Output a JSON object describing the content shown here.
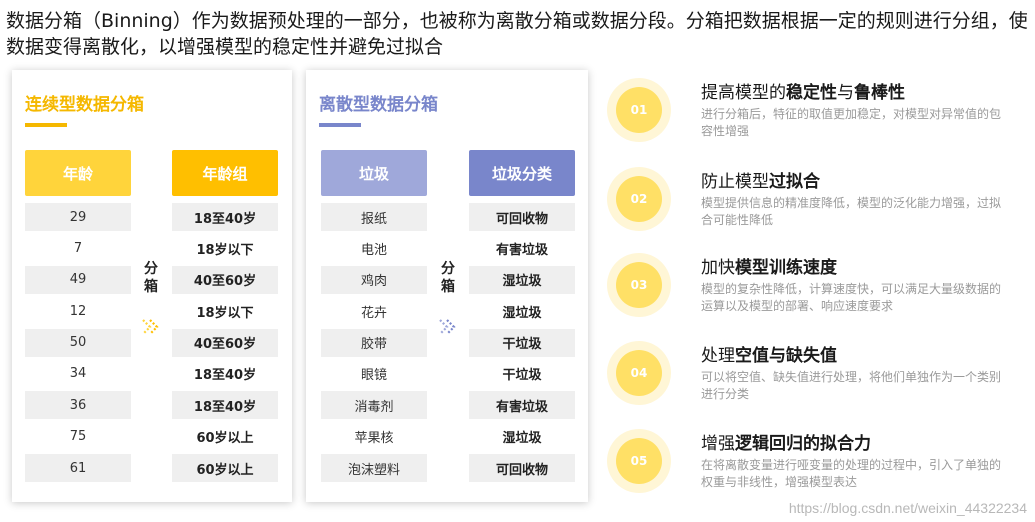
{
  "header": {
    "text": "数据分箱（Binning）作为数据预处理的一部分，也被称为离散分箱或数据分段。分箱把数据根据一定的规则进行分组，使数据变得离散化，以增强模型的稳定性并避免过拟合"
  },
  "continuous": {
    "title": "连续型数据分箱",
    "left_header": "年龄",
    "right_header": "年龄组",
    "mid_label": "分箱",
    "left": [
      "29",
      "7",
      "49",
      "12",
      "50",
      "34",
      "36",
      "75",
      "61"
    ],
    "right": [
      "18至40岁",
      "18岁以下",
      "40至60岁",
      "18岁以下",
      "40至60岁",
      "18至40岁",
      "18至40岁",
      "60岁以上",
      "60岁以上"
    ]
  },
  "discrete": {
    "title": "离散型数据分箱",
    "left_header": "垃圾",
    "right_header": "垃圾分类",
    "mid_label": "分箱",
    "left": [
      "报纸",
      "电池",
      "鸡肉",
      "花卉",
      "胶带",
      "眼镜",
      "消毒剂",
      "苹果核",
      "泡沫塑料"
    ],
    "right": [
      "可回收物",
      "有害垃圾",
      "湿垃圾",
      "湿垃圾",
      "干垃圾",
      "干垃圾",
      "有害垃圾",
      "湿垃圾",
      "可回收物"
    ]
  },
  "features": [
    {
      "num": "01",
      "title_pre": "提高模型的",
      "title_b1": "稳定性",
      "title_mid": "与",
      "title_b2": "鲁棒性",
      "desc": "进行分箱后，特征的取值更加稳定，对模型对异常值的包容性增强"
    },
    {
      "num": "02",
      "title_pre": "防止模型",
      "title_b1": "过拟合",
      "title_mid": "",
      "title_b2": "",
      "desc": "模型提供信息的精准度降低，模型的泛化能力增强，过拟合可能性降低"
    },
    {
      "num": "03",
      "title_pre": "加快",
      "title_b1": "模型训练速度",
      "title_mid": "",
      "title_b2": "",
      "desc": "模型的复杂性降低，计算速度快，可以满足大量级数据的运算以及模型的部署、响应速度要求"
    },
    {
      "num": "04",
      "title_pre": "处理",
      "title_b1": "空值与缺失值",
      "title_mid": "",
      "title_b2": "",
      "desc": "可以将空值、缺失值进行处理，将他们单独作为一个类别进行分类"
    },
    {
      "num": "05",
      "title_pre": "增强",
      "title_b1": "逻辑回归的拟合力",
      "title_mid": "",
      "title_b2": "",
      "desc": "在将离散变量进行哑变量的处理的过程中，引入了单独的权重与非线性，增强模型表达"
    }
  ],
  "watermark": "https://blog.csdn.net/weixin_44322234",
  "colors": {
    "yellow": "#ffd43b",
    "amber": "#ffbf00",
    "lavender": "#9fa8da",
    "indigo": "#7986cb",
    "circle_bg": "#fff6d6",
    "circle_fg": "#ffe066"
  }
}
